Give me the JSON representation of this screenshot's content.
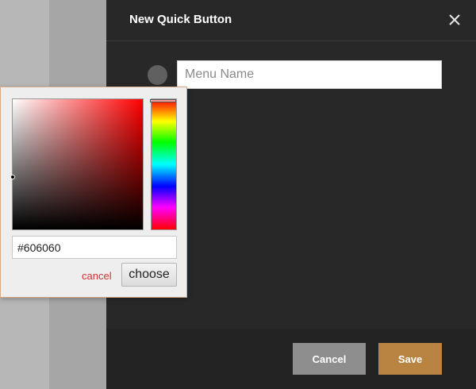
{
  "dialog": {
    "title": "New Quick Button",
    "close_icon": "close-icon",
    "name_placeholder": "Menu Name",
    "name_value": "",
    "selected_color": "#606060",
    "cancel_label": "Cancel",
    "save_label": "Save",
    "colors": {
      "background": "#282828",
      "footer": "#232323",
      "cancel_button": "#8e8e8e",
      "save_button": "#b98442"
    }
  },
  "color_picker": {
    "hex_value": "#606060",
    "cancel_label": "cancel",
    "choose_label": "choose",
    "hue_color": "#ff0000",
    "cancel_color": "#cc3333"
  }
}
